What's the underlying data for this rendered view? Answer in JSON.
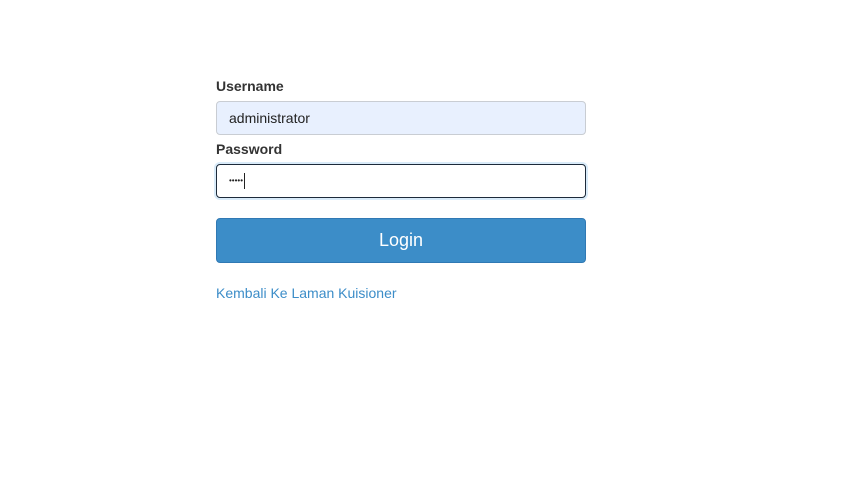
{
  "form": {
    "username_label": "Username",
    "username_value": "administrator",
    "password_label": "Password",
    "password_value_masked": "•••••",
    "login_button_label": "Login",
    "back_link_text": "Kembali Ke Laman Kuisioner"
  },
  "colors": {
    "primary": "#3c8dc8",
    "autofill_background": "#e8f0fe",
    "text": "#333333"
  }
}
